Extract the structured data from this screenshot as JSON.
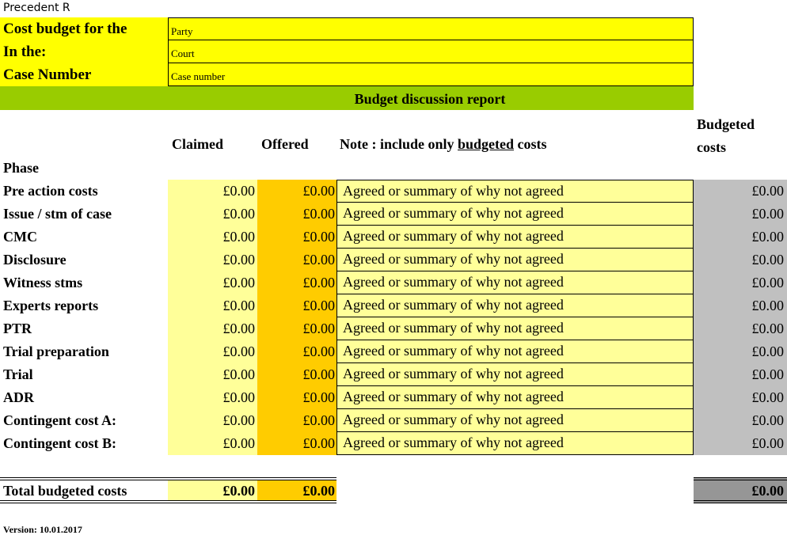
{
  "sheet_title": "Precedent R",
  "header": [
    {
      "label": "Cost budget for the",
      "value": "Party"
    },
    {
      "label": "In the:",
      "value": "Court"
    },
    {
      "label": "Case Number",
      "value": "Case number"
    }
  ],
  "banner": "Budget discussion report",
  "columns": {
    "claimed": "Claimed",
    "offered": "Offered",
    "note_prefix": "Note : include only ",
    "note_underlined": "budgeted",
    "note_suffix": " costs",
    "budgeted_line1": "Budgeted",
    "budgeted_line2": "costs",
    "phase": "Phase"
  },
  "rows": [
    {
      "phase": "Pre action costs",
      "claimed": "£0.00",
      "offered": "£0.00",
      "note": "Agreed or summary of why not agreed",
      "budgeted": "£0.00"
    },
    {
      "phase": "Issue / stm of case",
      "claimed": "£0.00",
      "offered": "£0.00",
      "note": "Agreed or summary of why not agreed",
      "budgeted": "£0.00"
    },
    {
      "phase": "CMC",
      "claimed": "£0.00",
      "offered": "£0.00",
      "note": "Agreed or summary of why not agreed",
      "budgeted": "£0.00"
    },
    {
      "phase": "Disclosure",
      "claimed": "£0.00",
      "offered": "£0.00",
      "note": "Agreed or summary of why not agreed",
      "budgeted": "£0.00"
    },
    {
      "phase": "Witness stms",
      "claimed": "£0.00",
      "offered": "£0.00",
      "note": "Agreed or summary of why not agreed",
      "budgeted": "£0.00"
    },
    {
      "phase": "Experts reports",
      "claimed": "£0.00",
      "offered": "£0.00",
      "note": "Agreed or summary of why not agreed",
      "budgeted": "£0.00"
    },
    {
      "phase": "PTR",
      "claimed": "£0.00",
      "offered": "£0.00",
      "note": "Agreed or summary of why not agreed",
      "budgeted": "£0.00"
    },
    {
      "phase": "Trial preparation",
      "claimed": "£0.00",
      "offered": "£0.00",
      "note": "Agreed or summary of why not agreed",
      "budgeted": "£0.00"
    },
    {
      "phase": "Trial",
      "claimed": "£0.00",
      "offered": "£0.00",
      "note": "Agreed or summary of why not agreed",
      "budgeted": "£0.00"
    },
    {
      "phase": "ADR",
      "claimed": "£0.00",
      "offered": "£0.00",
      "note": "Agreed or summary of why not agreed",
      "budgeted": "£0.00"
    },
    {
      "phase": "Contingent cost A:",
      "claimed": "£0.00",
      "offered": "£0.00",
      "note": "Agreed or summary of why not agreed",
      "budgeted": "£0.00"
    },
    {
      "phase": "Contingent cost B:",
      "claimed": "£0.00",
      "offered": "£0.00",
      "note": "Agreed or summary of why not agreed",
      "budgeted": "£0.00"
    }
  ],
  "total": {
    "label": "Total budgeted costs",
    "claimed": "£0.00",
    "offered": "£0.00",
    "budgeted": "£0.00"
  },
  "version": "Version: 10.01.2017",
  "colors": {
    "yellow": "#ffff00",
    "green": "#99cc00",
    "light_yellow": "#ffff99",
    "orange": "#ffcc00",
    "grey": "#c0c0c0",
    "dark_grey": "#969696"
  }
}
